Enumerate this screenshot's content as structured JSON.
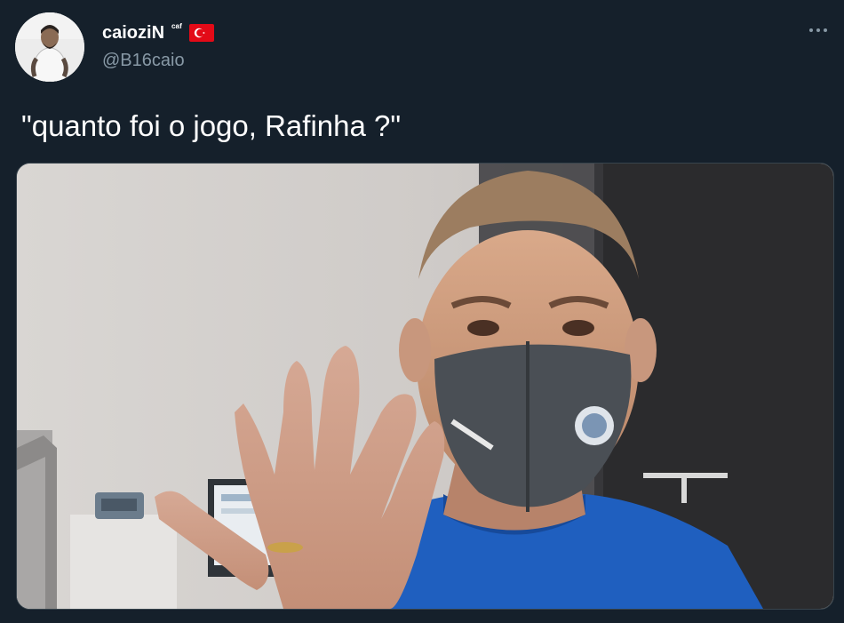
{
  "author": {
    "display_name": "caioziN",
    "name_suffix": "ᶜᵃᶠ",
    "handle": "@B16caio",
    "flag_icon": "turkey-flag-icon",
    "avatar_icon": "avatar-photo"
  },
  "tweet": {
    "text": "\"quanto foi o jogo, Rafinha ?\"",
    "more_icon": "more-options-icon",
    "media_description_icon": "photo-media"
  },
  "colors": {
    "background": "#15202b",
    "primary_text": "#ffffff",
    "secondary_text": "#8899a6",
    "border": "#38444d",
    "flag_red": "#e30a17"
  }
}
